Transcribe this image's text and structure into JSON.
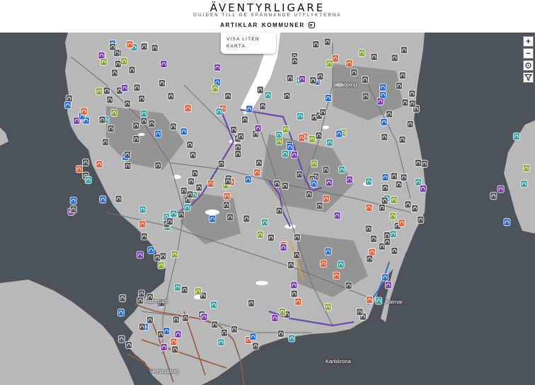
{
  "header": {
    "title": "ÄVENTYRLIGARE",
    "tagline": "GUIDEN TILL DE SPÄNNANDE UTFLYKTERNA",
    "nav": [
      "ARTIKLAR",
      "KOMMUNER"
    ],
    "instagram_icon": "instagram-icon"
  },
  "map_toggle": {
    "label": "VISA LITEN KARTA"
  },
  "map_controls": {
    "zoom_in": "+",
    "zoom_out": "−",
    "locate_icon": "crosshair-icon",
    "filter_icon": "filter-icon"
  },
  "places": {
    "linkoping": "Linköping",
    "halmstad": "Halmstad",
    "helsingborg": "Helsingborg",
    "karlskrona": "Karlskrona",
    "kalmar": "Kalmar"
  },
  "colors": {
    "sea": "#4d535b",
    "land": "#b7b7b7",
    "forest": "#8f8f8f",
    "lake": "#ffffff",
    "road": "#6a6a6a",
    "trail_purple": "#6b4ab0",
    "trail_brown": "#9a5a3a",
    "marker_gray": "#555555",
    "marker_blue": "#2a6bd6",
    "marker_orange": "#e0603a",
    "marker_green": "#8aa83a",
    "marker_teal": "#3aa0a0",
    "marker_purple": "#7a3ab0"
  }
}
